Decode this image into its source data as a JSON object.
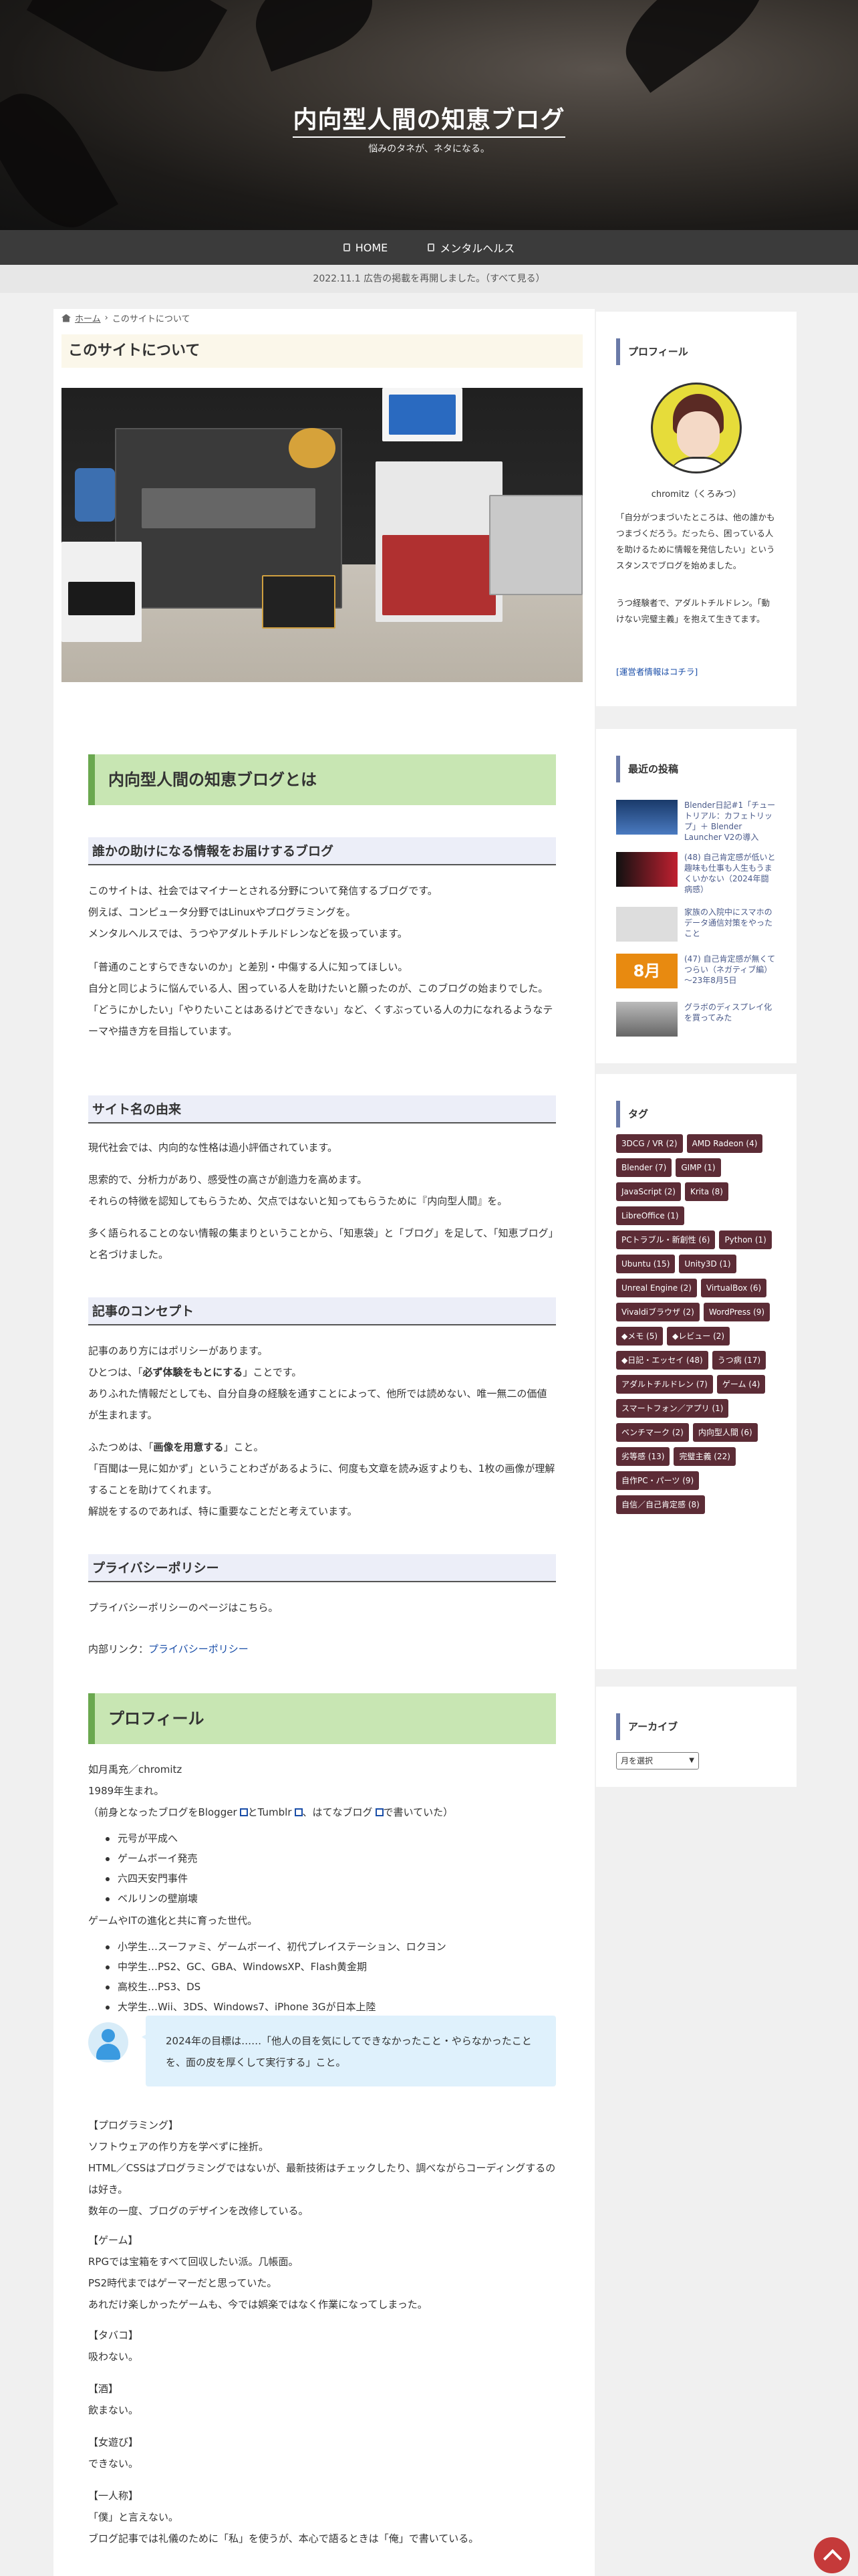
{
  "site": {
    "title": "内向型人間の知恵ブログ",
    "tagline": "悩みのタネが、ネタになる。"
  },
  "nav": [
    {
      "label": "HOME",
      "icon": "home-icon"
    },
    {
      "label": "メンタルヘルス",
      "icon": "folder-icon"
    }
  ],
  "notice": "2022.11.1 広告の掲載を再開しました。（すべて見る）",
  "breadcrumb": {
    "home": "ホーム",
    "sep": "›",
    "current": "このサイトについて"
  },
  "page_title": "このサイトについて",
  "sec1": {
    "h2": "内向型人間の知恵ブログとは",
    "h3": "誰かの助けになる情報をお届けするブログ",
    "p1": [
      "このサイトは、社会ではマイナーとされる分野について発信するブログです。",
      "例えば、コンピュータ分野ではLinuxやプログラミングを。",
      "メンタルヘルスでは、うつやアダルトチルドレンなどを扱っています。"
    ],
    "p2": [
      "「普通のことすらできないのか」と差別・中傷する人に知ってほしい。",
      "自分と同じように悩んでいる人、困っている人を助けたいと願ったのが、このブログの始まりでした。",
      "「どうにかしたい」「やりたいことはあるけどできない」など、くすぶっている人の力になれるようなテーマや描き方を目指しています。"
    ]
  },
  "sec2": {
    "h3": "サイト名の由来",
    "p1": "現代社会では、内向的な性格は過小評価されています。",
    "p2": [
      "思索的で、分析力があり、感受性の高さが創造力を高めます。",
      "それらの特徴を認知してもらうため、欠点ではないと知ってもらうために『内向型人間』を。"
    ],
    "p3": "多く語られることのない情報の集まりということから、「知恵袋」と「ブログ」を足して、「知恵ブログ」と名づけました。"
  },
  "sec3": {
    "h3": "記事のコンセプト",
    "p1a": "記事のあり方にはポリシーがあります。",
    "p1b_pre": "ひとつは、「",
    "p1b_bold": "必ず体験をもとにする",
    "p1b_post": "」ことです。",
    "p1c": "ありふれた情報だとしても、自分自身の経験を通すことによって、他所では読めない、唯一無二の価値が生まれます。",
    "p2a_pre": "ふたつめは、「",
    "p2a_bold": "画像を用意する",
    "p2a_post": "」こと。",
    "p2b": "「百聞は一見に如かず」ということわざがあるように、何度も文章を読み返すよりも、1枚の画像が理解することを助けてくれます。",
    "p2c": "解説をするのであれば、特に重要なことだと考えています。"
  },
  "sec4": {
    "h3": "プライバシーポリシー",
    "p1": "プライバシーポリシーのページはこちら。",
    "link_pre": "内部リンク：",
    "link": "プライバシーポリシー"
  },
  "profile": {
    "h2": "プロフィール",
    "name": "如月禹充／chromitz",
    "born": "1989年生まれ。",
    "prev_pre": "（前身となったブログをBlogger",
    "prev_mid1": "とTumblr",
    "prev_mid2": "、はてなブログ",
    "prev_post": "で書いていた）",
    "blogger": "Blogger",
    "tumblr": "Tumblr",
    "hatena": "はてなブログ",
    "list1": [
      "元号が平成へ",
      "ゲームボーイ発売",
      "六四天安門事件",
      "ベルリンの壁崩壊"
    ],
    "gen": "ゲームやITの進化と共に育った世代。",
    "list2": [
      "小学生…スーファミ、ゲームボーイ、初代プレイステーション、ロクヨン",
      "中学生…PS2、GC、GBA、WindowsXP、Flash黄金期",
      "高校生…PS3、DS",
      "大学生…Wii、3DS、Windows7、iPhone 3Gが日本上陸"
    ],
    "quote": "2024年の目標は……「他人の目を気にしてできなかったこと・やらなかったことを、面の皮を厚くして実行する」こと。",
    "prog_h": "【プログラミング】",
    "prog": [
      "ソフトウェアの作り方を学べずに挫折。",
      "HTML／CSSはプログラミングではないが、最新技術はチェックしたり、調べながらコーディングするのは好き。",
      "数年の一度、ブログのデザインを改修している。"
    ],
    "game_h": "【ゲーム】",
    "game": [
      "RPGでは宝箱をすべて回収したい派。几帳面。",
      "PS2時代まではゲーマーだと思っていた。",
      "あれだけ楽しかったゲームも、今では娯楽ではなく作業になってしまった。"
    ],
    "tabako_h": "【タバコ】",
    "tabako": "吸わない。",
    "sake_h": "【酒】",
    "sake": "飲まない。",
    "onna_h": "【女遊び】",
    "onna": "できない。",
    "ichi_h": "【一人称】",
    "ichi": [
      "「僕」と言えない。",
      "ブログ記事では礼儀のために「私」を使うが、本心で語るときは「俺」で書いている。"
    ]
  },
  "side_profile": {
    "title": "プロフィール",
    "name": "chromitz（くろみつ）",
    "p1": "「自分がつまづいたところは、他の誰かもつまづくだろう。だったら、困っている人を助けるために情報を発信したい」というスタンスでブログを始めました。",
    "p2": "うつ経験者で、アダルトチルドレン。「動けない完璧主義」を抱えて生きてます。",
    "link": "[運営者情報はコチラ]"
  },
  "side_recent": {
    "title": "最近の投稿",
    "items": [
      {
        "text": "Blender日記#1「チュートリアル：カフェトリップ」＋ Blender Launcher V2の導入"
      },
      {
        "text": "(48) 自己肯定感が低いと趣味も仕事も人生もうまくいかない（2024年闘病感）"
      },
      {
        "text": "家族の入院中にスマホのデータ通信対策をやったこと"
      },
      {
        "text": "(47) 自己肯定感が無くてつらい（ネガティブ編）～23年8月5日",
        "thumb": "8月"
      },
      {
        "text": "グラボのディスプレイ化を買ってみた"
      }
    ]
  },
  "side_tags": {
    "title": "タグ",
    "tags": [
      "3DCG / VR (2)",
      "AMD Radeon (4)",
      "Blender (7)",
      "GIMP (1)",
      "JavaScript (2)",
      "Krita (8)",
      "LibreOffice (1)",
      "PCトラブル・新創性 (6)",
      "Python (1)",
      "Ubuntu (15)",
      "Unity3D (1)",
      "Unreal Engine (2)",
      "VirtualBox (6)",
      "Vivaldiブラウザ (2)",
      "WordPress (9)",
      "◆メモ (5)",
      "◆レビュー (2)",
      "◆日記・エッセイ (48)",
      "うつ病 (17)",
      "アダルトチルドレン (7)",
      "ゲーム (4)",
      "スマートフォン／アプリ (1)",
      "ベンチマーク (2)",
      "内向型人間 (6)",
      "劣等感 (13)",
      "完璧主義 (22)",
      "自作PC・パーツ (9)",
      "自信／自己肯定感 (8)"
    ]
  },
  "side_archive": {
    "title": "アーカイブ",
    "select": "月を選択"
  },
  "colors": {
    "accent_green": "#6aa84f",
    "tag_bg": "#5c2c36",
    "totop": "#c53a3a"
  }
}
